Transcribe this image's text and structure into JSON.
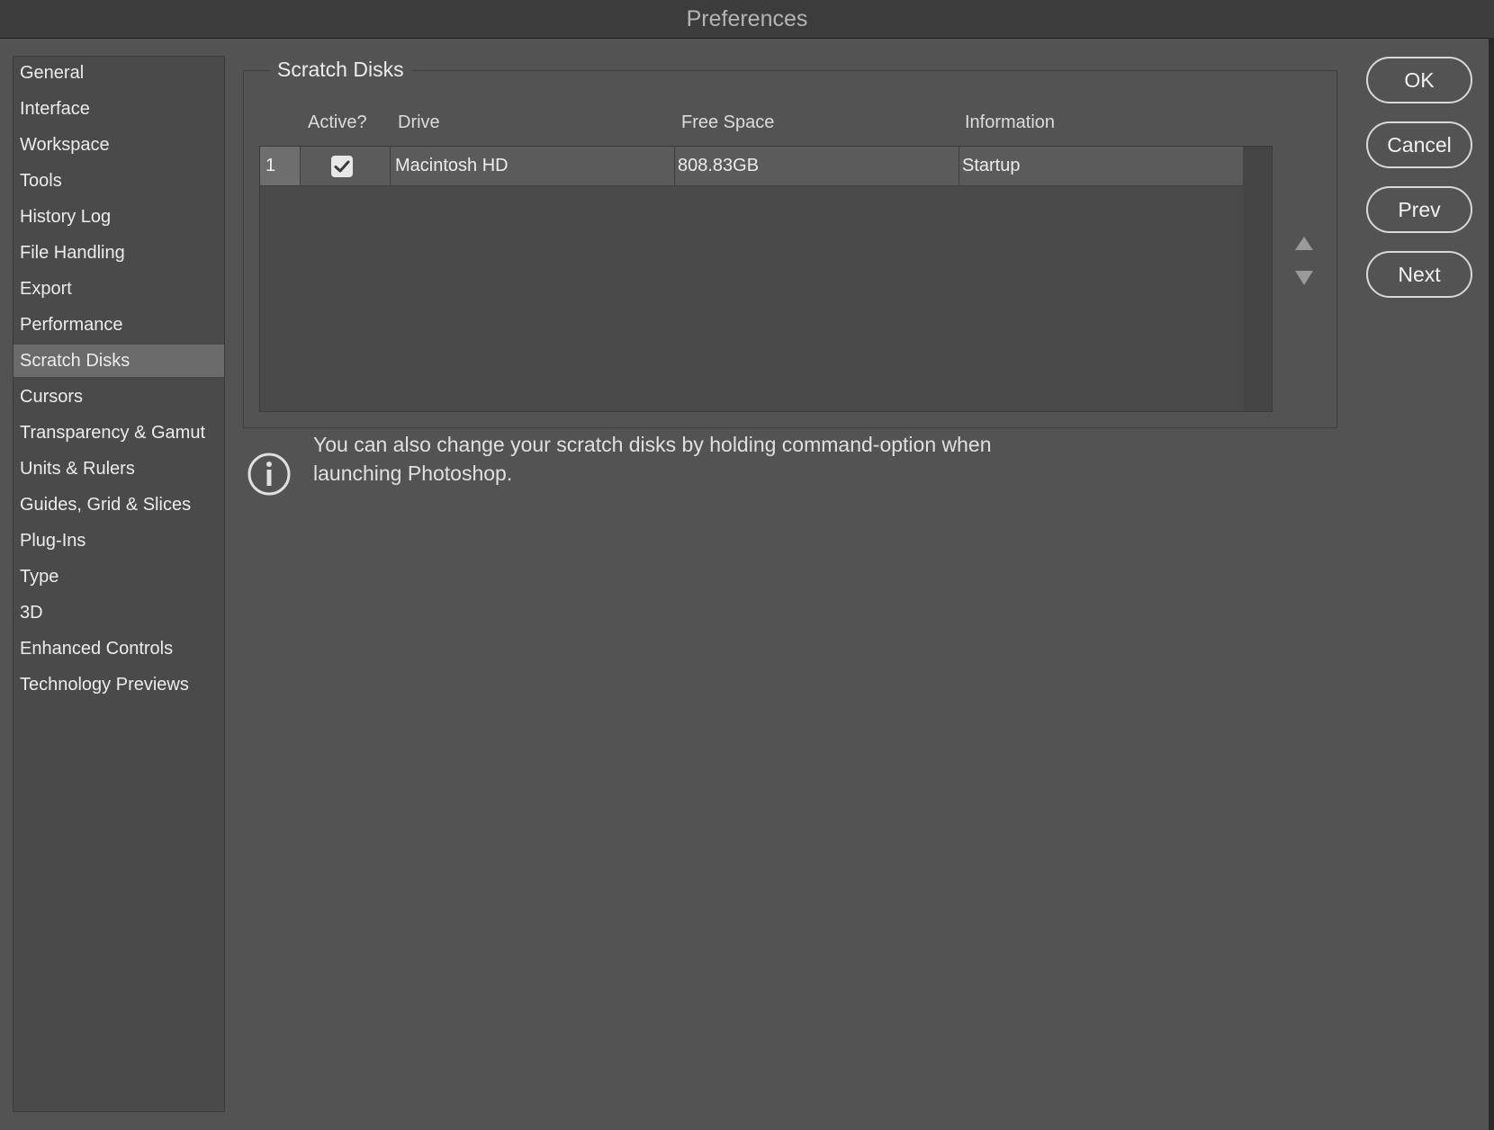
{
  "window": {
    "title": "Preferences"
  },
  "sidebar": {
    "items": [
      {
        "label": "General"
      },
      {
        "label": "Interface"
      },
      {
        "label": "Workspace"
      },
      {
        "label": "Tools"
      },
      {
        "label": "History Log"
      },
      {
        "label": "File Handling"
      },
      {
        "label": "Export"
      },
      {
        "label": "Performance"
      },
      {
        "label": "Scratch Disks",
        "selected": true
      },
      {
        "label": "Cursors"
      },
      {
        "label": "Transparency & Gamut"
      },
      {
        "label": "Units & Rulers"
      },
      {
        "label": "Guides, Grid & Slices"
      },
      {
        "label": "Plug-Ins"
      },
      {
        "label": "Type"
      },
      {
        "label": "3D"
      },
      {
        "label": "Enhanced Controls"
      },
      {
        "label": "Technology Previews"
      }
    ]
  },
  "scratch_disks": {
    "group_title": "Scratch Disks",
    "columns": {
      "active": "Active?",
      "drive": "Drive",
      "free_space": "Free Space",
      "information": "Information"
    },
    "rows": [
      {
        "index": "1",
        "active": true,
        "drive": "Macintosh HD",
        "free_space": "808.83GB",
        "information": "Startup"
      }
    ],
    "move_up_icon": "triangle-up-icon",
    "move_down_icon": "triangle-down-icon"
  },
  "info": {
    "icon": "info-icon",
    "line1": "You can also change your scratch disks by holding command-option when",
    "line2": "launching Photoshop."
  },
  "buttons": {
    "ok": "OK",
    "cancel": "Cancel",
    "prev": "Prev",
    "next": "Next"
  },
  "colors": {
    "background": "#535353",
    "titlebar": "#3c3c3c",
    "selected_item": "#6b6b6b"
  }
}
